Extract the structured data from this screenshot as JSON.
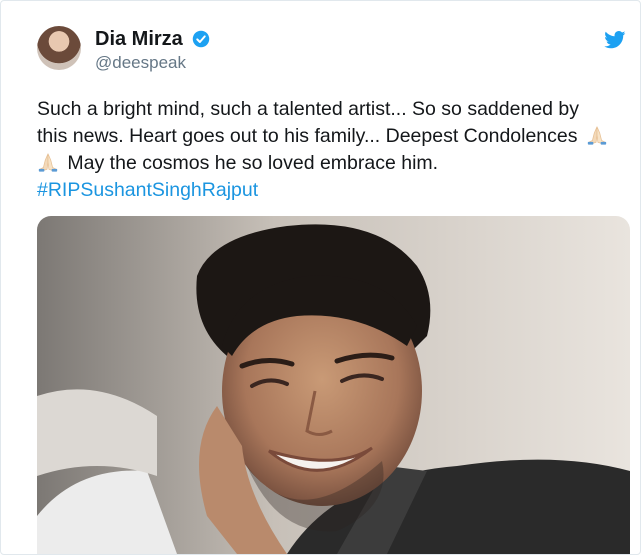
{
  "tweet": {
    "author_name": "Dia Mirza",
    "author_handle": "@deespeak",
    "text_line1": "Such a bright mind, such a talented artist... So so saddened  by",
    "text_line2_before_emoji": "this news. Heart goes out to his family... Deepest Condolences",
    "text_line3_after_emoji": "May the cosmos he so loved embrace him.",
    "hashtag": "#RIPSushantSinghRajput",
    "emoji": "folded-hands"
  },
  "icons": {
    "verified": "verified-badge-icon",
    "logo": "twitter-bird-icon"
  },
  "colors": {
    "name": "#14171a",
    "handle": "#657786",
    "hashtag": "#1b95e0",
    "verified": "#1da1f2",
    "bird": "#1da1f2"
  }
}
